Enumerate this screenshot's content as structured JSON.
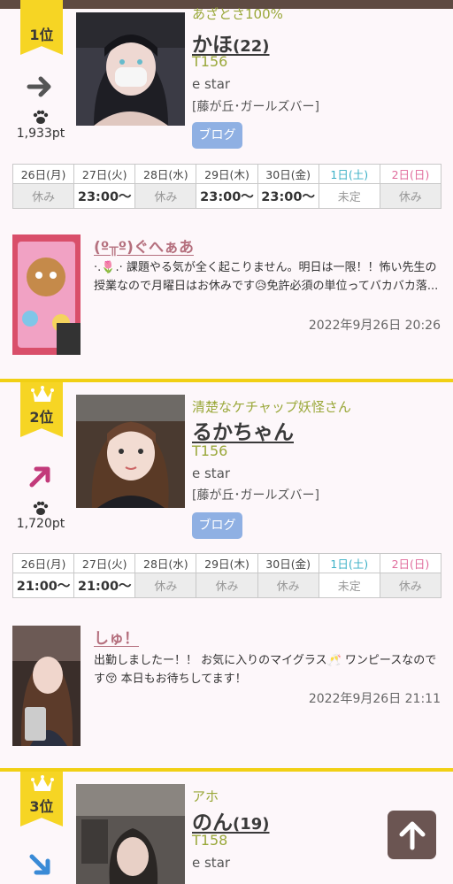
{
  "entries": [
    {
      "rank": "1位",
      "trend": "flat",
      "points": "1,933pt",
      "catchphrase": "あざとさ100%",
      "name": "かほ",
      "age": "(22)",
      "height": "T156",
      "shop": "e star",
      "area": "[藤が丘･ガールズバー]",
      "blog_label": "ブログ",
      "schedule": [
        {
          "day": "26日(月)",
          "value": "休み",
          "status": "off"
        },
        {
          "day": "27日(火)",
          "value": "23:00〜",
          "status": "work"
        },
        {
          "day": "28日(水)",
          "value": "休み",
          "status": "off"
        },
        {
          "day": "29日(木)",
          "value": "23:00〜",
          "status": "work"
        },
        {
          "day": "30日(金)",
          "value": "23:00〜",
          "status": "work"
        },
        {
          "day": "1日(土)",
          "value": "未定",
          "status": "tbd"
        },
        {
          "day": "2日(日)",
          "value": "休み",
          "status": "off"
        }
      ],
      "post": {
        "title": "(º╥º)ぐへぁあ",
        "body": "·.🌷.· 課題やる気が全く起こりません。明日は一限！！怖い先生の授業なので月曜日はお休みです😥免許必須の単位ってバカバカ落...",
        "date": "2022年9月26日 20:26"
      }
    },
    {
      "rank": "2位",
      "trend": "up",
      "points": "1,720pt",
      "catchphrase": "清楚なケチャップ妖怪さん",
      "name": "るかちゃん",
      "age": "",
      "height": "T156",
      "shop": "e star",
      "area": "[藤が丘･ガールズバー]",
      "blog_label": "ブログ",
      "schedule": [
        {
          "day": "26日(月)",
          "value": "21:00〜",
          "status": "work"
        },
        {
          "day": "27日(火)",
          "value": "21:00〜",
          "status": "work"
        },
        {
          "day": "28日(水)",
          "value": "休み",
          "status": "off"
        },
        {
          "day": "29日(木)",
          "value": "休み",
          "status": "off"
        },
        {
          "day": "30日(金)",
          "value": "休み",
          "status": "off"
        },
        {
          "day": "1日(土)",
          "value": "未定",
          "status": "tbd"
        },
        {
          "day": "2日(日)",
          "value": "休み",
          "status": "off"
        }
      ],
      "post": {
        "title": "しゅ！",
        "body": "出勤しましたー！！ お気に入りのマイグラス🥂 ワンピースなのです😚 本日もお待ちしてます！",
        "date": "2022年9月26日 21:11"
      }
    },
    {
      "rank": "3位",
      "trend": "down",
      "catchphrase": "アホ",
      "name": "のん",
      "age": "(19)",
      "height": "T158",
      "shop": "e star"
    }
  ],
  "colors": {
    "badge": "#f6d524",
    "separator": "#f1d014",
    "catchphrase": "#9aa83a",
    "post_title": "#b5707e",
    "blog_button": "#8fb0e3",
    "saturday": "#3bb0c6",
    "sunday": "#e06a9b"
  },
  "icons": {
    "crown": "crown-icon",
    "trend_flat": "arrow-right-icon",
    "trend_up": "arrow-up-right-icon",
    "trend_down": "arrow-down-right-icon",
    "paw": "paw-icon",
    "scroll_top": "arrow-up-icon"
  }
}
